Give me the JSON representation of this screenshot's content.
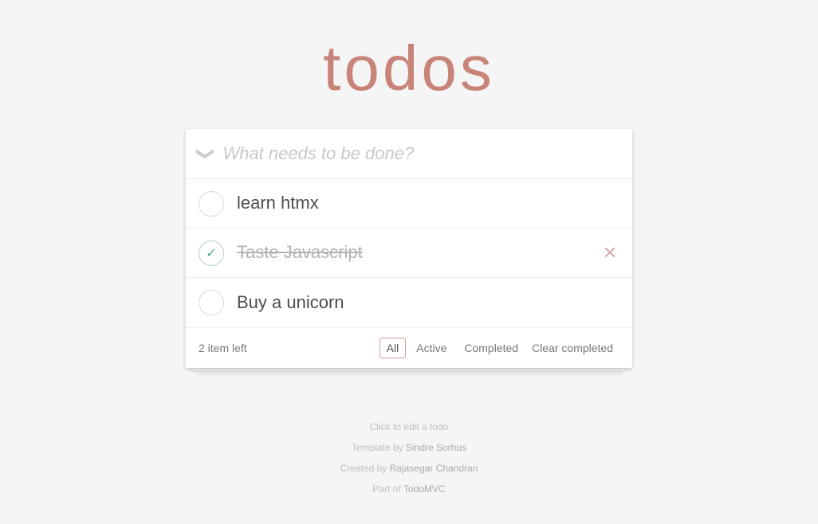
{
  "app": {
    "title": "todos"
  },
  "new_todo": {
    "placeholder": "What needs to be done?"
  },
  "toggle_all": {
    "symbol": "❯"
  },
  "todos": [
    {
      "id": 1,
      "text": "learn htmx",
      "completed": false
    },
    {
      "id": 2,
      "text": "Taste Javascript",
      "completed": true
    },
    {
      "id": 3,
      "text": "Buy a unicorn",
      "completed": false
    }
  ],
  "footer": {
    "items_left": "2 item left",
    "filters": [
      {
        "label": "All",
        "active": true
      },
      {
        "label": "Active",
        "active": false
      },
      {
        "label": "Completed",
        "active": false
      }
    ],
    "clear_completed": "Clear completed"
  },
  "info": {
    "hint": "Click to edit a todo",
    "template_prefix": "Template by ",
    "template_author": "Sindre Sorhus",
    "created_prefix": "Created by ",
    "created_author": "Rajasegar Chandran",
    "part_prefix": "Part of ",
    "part_link": "TodoMVC"
  },
  "colors": {
    "title": "#c9847a",
    "checked": "#4CAF82",
    "border": "#ededed"
  }
}
